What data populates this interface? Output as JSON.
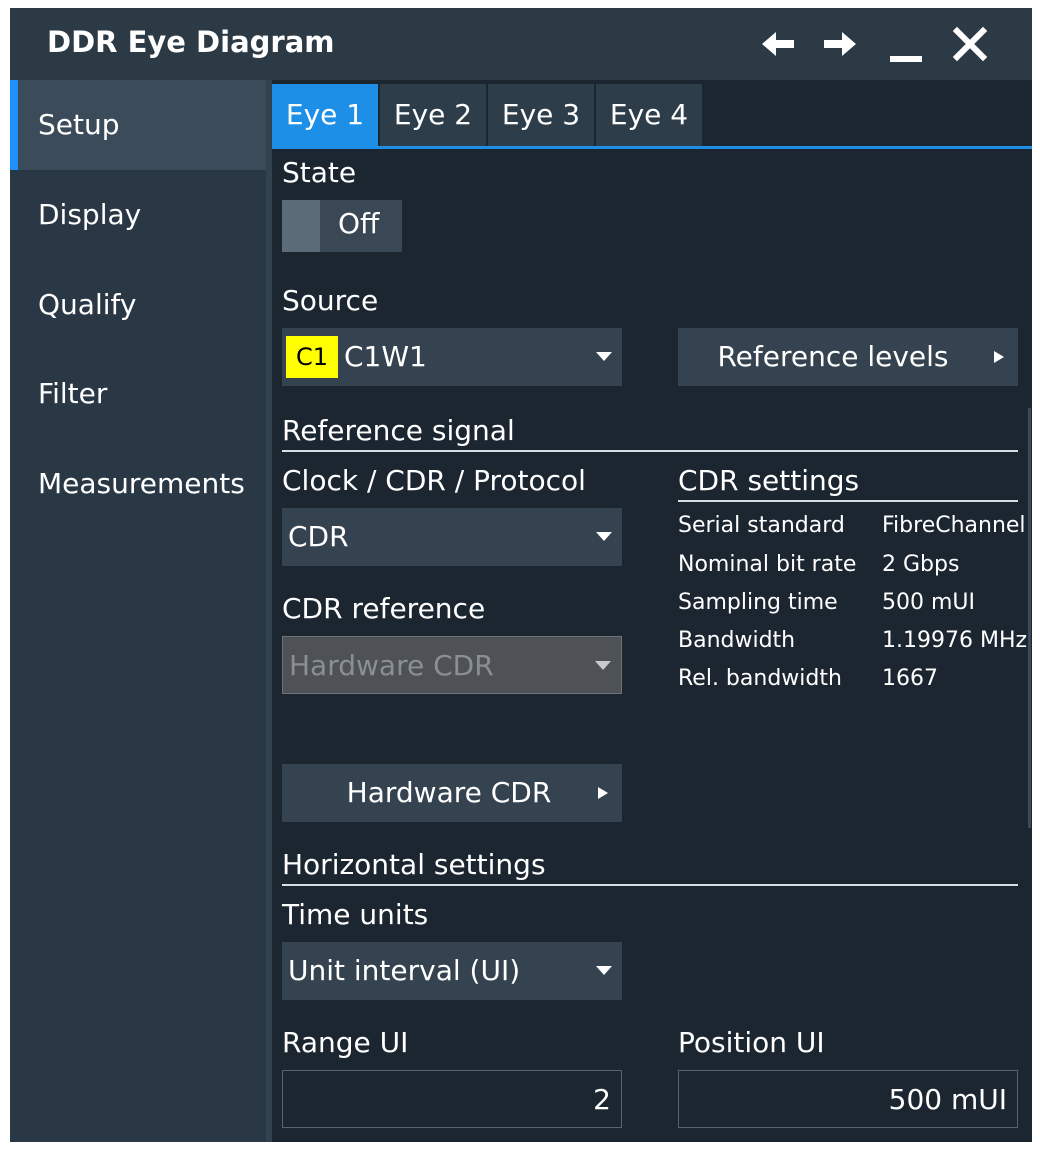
{
  "window": {
    "title": "DDR Eye Diagram",
    "icons": [
      "arrow-left-icon",
      "arrow-right-icon",
      "minimize-icon",
      "close-icon"
    ]
  },
  "sidebar": {
    "items": [
      {
        "label": "Setup",
        "active": true
      },
      {
        "label": "Display",
        "active": false
      },
      {
        "label": "Qualify",
        "active": false
      },
      {
        "label": "Filter",
        "active": false
      },
      {
        "label": "Measurements",
        "active": false
      }
    ]
  },
  "tabs": [
    {
      "label": "Eye 1",
      "active": true
    },
    {
      "label": "Eye 2",
      "active": false
    },
    {
      "label": "Eye 3",
      "active": false
    },
    {
      "label": "Eye 4",
      "active": false
    }
  ],
  "state": {
    "label": "State",
    "toggle_value": "Off"
  },
  "source": {
    "label": "Source",
    "badge": "C1",
    "value": "C1W1",
    "badge_color": "#ffff00"
  },
  "reference_levels": {
    "label": "Reference levels"
  },
  "reference_signal": {
    "section_title": "Reference signal",
    "clock_label": "Clock / CDR / Protocol",
    "clock_value": "CDR",
    "cdr_reference_label": "CDR reference",
    "cdr_reference_value": "Hardware CDR",
    "hardware_cdr_button": "Hardware CDR"
  },
  "cdr_settings": {
    "title": "CDR settings",
    "rows": [
      {
        "key": "Serial standard",
        "value": "FibreChannel"
      },
      {
        "key": "Nominal bit rate",
        "value": "2 Gbps"
      },
      {
        "key": "Sampling time",
        "value": "500 mUI"
      },
      {
        "key": "Bandwidth",
        "value": "1.19976 MHz"
      },
      {
        "key": "Rel. bandwidth",
        "value": "1667"
      }
    ]
  },
  "horizontal": {
    "section_title": "Horizontal settings",
    "time_units_label": "Time units",
    "time_units_value": "Unit interval (UI)",
    "range_label": "Range UI",
    "range_value": "2",
    "position_label": "Position UI",
    "position_value": "500 mUI"
  },
  "colors": {
    "accent": "#1e8fe6",
    "background": "#1c2630",
    "sidebar": "#2a3845"
  }
}
